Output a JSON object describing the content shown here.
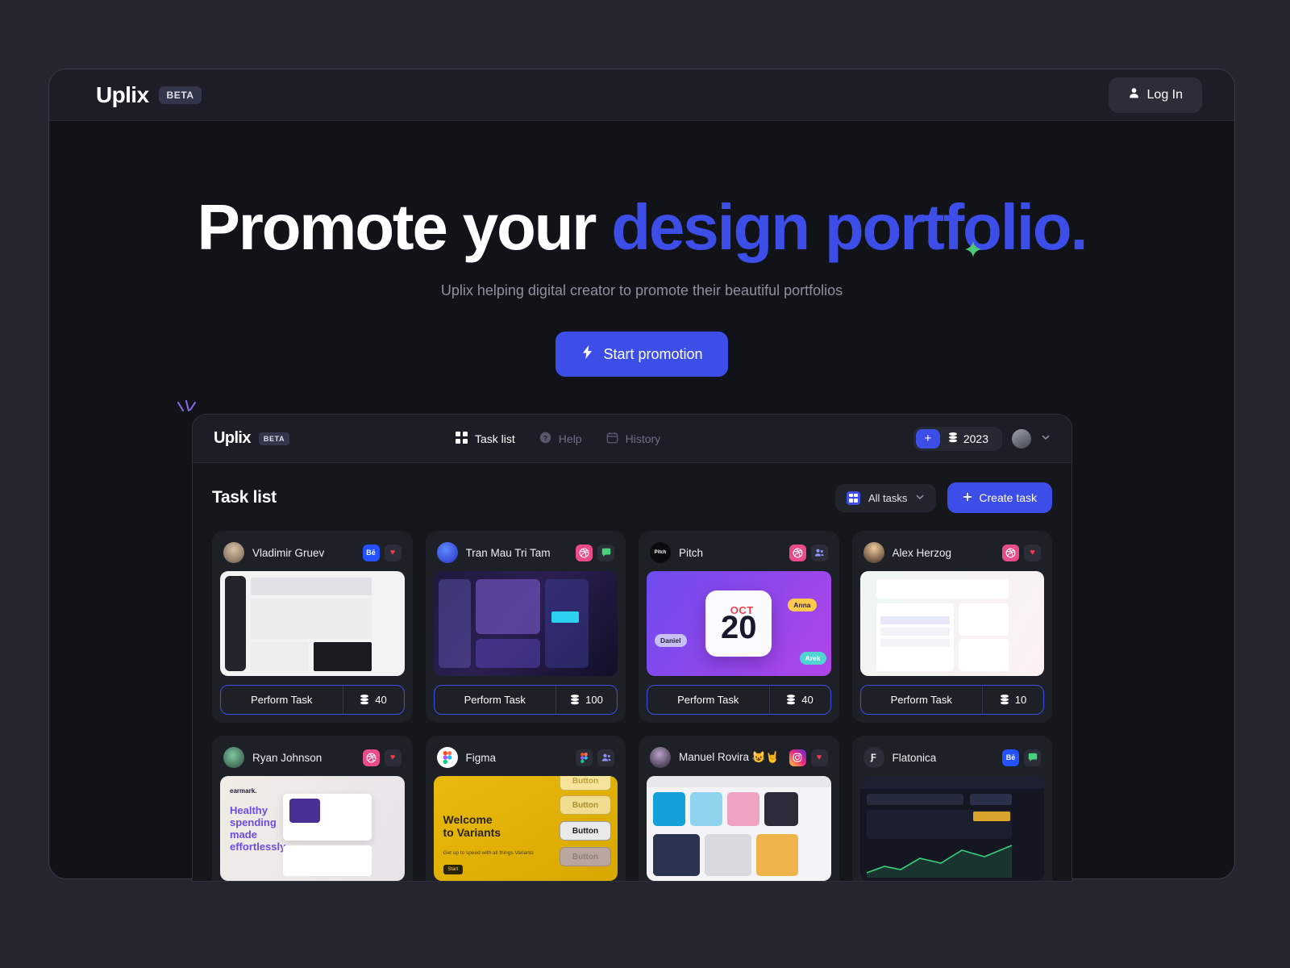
{
  "site": {
    "brand": "Uplix",
    "beta": "BETA",
    "login_label": "Log In",
    "login_icon": "user-icon"
  },
  "hero": {
    "heading_plain": "Promote your ",
    "heading_accent": "design portfolio.",
    "subheading": "Uplix helping digital creator to promote their beautiful portfolios",
    "cta_label": "Start promotion",
    "cta_icon": "bolt-icon",
    "accent_color": "#3d4ee8",
    "star_color": "#4fc879"
  },
  "app": {
    "brand": "Uplix",
    "beta": "BETA",
    "nav": [
      {
        "label": "Task list",
        "icon": "grid-icon",
        "active": true
      },
      {
        "label": "Help",
        "icon": "question-circle-icon",
        "active": false
      },
      {
        "label": "History",
        "icon": "calendar-icon",
        "active": false
      }
    ],
    "coins": {
      "plus_label": "+",
      "value": "2023",
      "icon": "coins-icon"
    },
    "account": {
      "avatar": "user-avatar",
      "chevron": "chevron-down-icon"
    },
    "page_title": "Task list",
    "filter": {
      "label": "All tasks",
      "icon": "grid-icon",
      "chevron": "chevron-down-icon"
    },
    "create_label": "Create task",
    "create_icon": "plus-icon",
    "perform_label": "Perform Task"
  },
  "tasks": [
    {
      "name": "Vladimir Gruev",
      "avatar": "photo-avatar",
      "badges": [
        "behance",
        "heart"
      ],
      "cost": "40",
      "thumb": "dashboard-light"
    },
    {
      "name": "Tran Mau Tri Tam",
      "avatar": "shield-logo",
      "badges": [
        "dribbble",
        "comment"
      ],
      "cost": "100",
      "thumb": "dark-3d-dashboard"
    },
    {
      "name": "Pitch",
      "avatar": "pitch-logo",
      "badges": [
        "dribbble",
        "people"
      ],
      "cost": "40",
      "thumb": "pitch-calendar"
    },
    {
      "name": "Alex Herzog",
      "avatar": "photo-avatar",
      "badges": [
        "dribbble",
        "heart"
      ],
      "cost": "10",
      "thumb": "mail-inbox-light"
    },
    {
      "name": "Ryan Johnson",
      "avatar": "photo-avatar",
      "badges": [
        "dribbble",
        "heart"
      ],
      "cost": "",
      "thumb": "earmark-app"
    },
    {
      "name": "Figma",
      "avatar": "figma-logo",
      "badges": [
        "figma",
        "people"
      ],
      "cost": "",
      "thumb": "figma-variants"
    },
    {
      "name": "Manuel Rovira 😺🤘",
      "avatar": "photo-avatar",
      "badges": [
        "instagram",
        "heart"
      ],
      "cost": "",
      "thumb": "nft-marketplace"
    },
    {
      "name": "Flatonica",
      "avatar": "flatonica-logo",
      "badges": [
        "behance",
        "comment"
      ],
      "cost": "",
      "thumb": "trading-dark"
    }
  ],
  "thumbs": {
    "pitch": {
      "month": "OCT",
      "day": "20",
      "cursors": [
        "Anna",
        "Daniel",
        "Arek"
      ]
    },
    "earmark": {
      "logo": "earmark.",
      "headline_1": "Healthy",
      "headline_2": "spending",
      "headline_3": "made",
      "headline_4": "effortlessly."
    },
    "figma": {
      "headline_1": "Welcome",
      "headline_2": "to Variants",
      "subline": "Get up to speed with all things Variants",
      "pill": "Start",
      "buttons": [
        "Button",
        "Button",
        "Button",
        "Button"
      ]
    }
  }
}
